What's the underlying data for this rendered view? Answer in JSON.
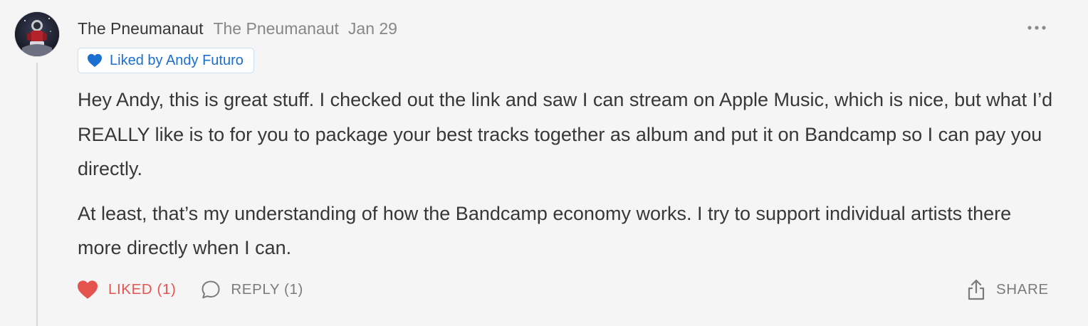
{
  "comment": {
    "author_name": "The Pneumanaut",
    "author_handle": "The Pneumanaut",
    "date": "Jan 29",
    "liked_by": "Liked by Andy Futuro",
    "paragraphs": [
      "Hey Andy, this is great stuff. I checked out the link and saw I can stream on Apple Music, which is nice, but what I’d REALLY like is to for you to package your best tracks together as album and put it on Bandcamp so I can pay you directly.",
      "At least, that’s my understanding of how the Bandcamp economy works. I try to support individual artists there more directly when I can."
    ]
  },
  "actions": {
    "like_label": "LIKED (1)",
    "reply_label": "REPLY (1)",
    "share_label": "SHARE"
  },
  "icons": {
    "avatar": "astronaut-avatar",
    "more": "more-horizontal-icon",
    "liked_by_heart": "heart-filled-icon",
    "like": "heart-filled-icon",
    "reply": "speech-bubble-icon",
    "share": "share-upload-icon"
  },
  "colors": {
    "background": "#f5f5f5",
    "text": "#363737",
    "muted": "#868787",
    "liked_red": "#e5534f",
    "liked_by_blue": "#1a6fd0",
    "badge_border": "#c9dff4"
  }
}
